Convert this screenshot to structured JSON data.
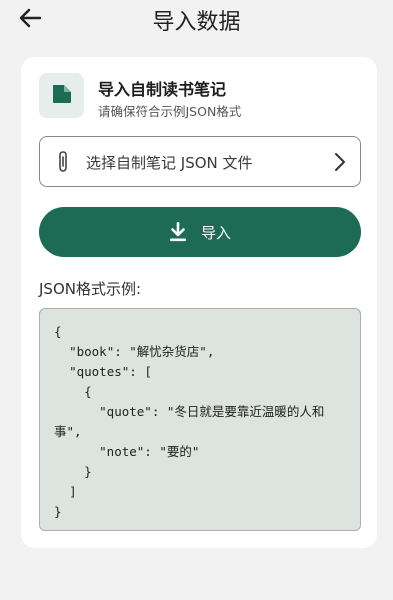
{
  "header": {
    "title": "导入数据",
    "back_icon": "arrow-left-icon"
  },
  "info": {
    "icon": "document-icon",
    "title": "导入自制读书笔记",
    "subtitle": "请确保符合示例JSON格式"
  },
  "file_picker": {
    "icon": "paperclip-icon",
    "label": "选择自制笔记 JSON 文件",
    "trailing_icon": "chevron-right-icon"
  },
  "import_button": {
    "icon": "download-icon",
    "label": "导入"
  },
  "example": {
    "label": "JSON格式示例:",
    "code": "{\n  \"book\": \"解忧杂货店\",\n  \"quotes\": [\n    {\n      \"quote\": \"冬日就是要靠近温暖的人和事\",\n      \"note\": \"要的\"\n    }\n  ]\n}"
  },
  "colors": {
    "accent": "#1d6b55",
    "icon_bg": "#e6eeeb",
    "code_bg": "#dde3df",
    "page_bg": "#f2f2f2"
  }
}
